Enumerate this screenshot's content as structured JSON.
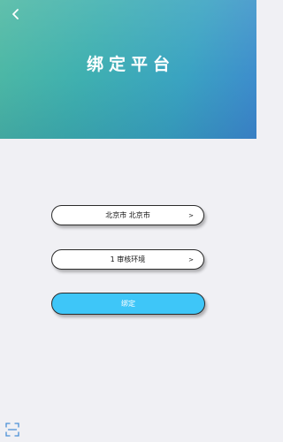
{
  "header": {
    "title": "绑定平台",
    "back_icon": "chevron-left-icon"
  },
  "form": {
    "city_selector": {
      "label": "北京市 北京市",
      "arrow": ">"
    },
    "environment_selector": {
      "label": "1 审核环境",
      "arrow": ">"
    },
    "bind_button": {
      "label": "绑定"
    }
  },
  "footer": {
    "scan_icon": "scan-icon"
  },
  "colors": {
    "header_gradient_start": "#4fb9a3",
    "header_gradient_end": "#3e88cf",
    "page_background": "#f0f0f4",
    "button_accent": "#3ec6f8",
    "scan_icon": "#4a8fd6"
  }
}
